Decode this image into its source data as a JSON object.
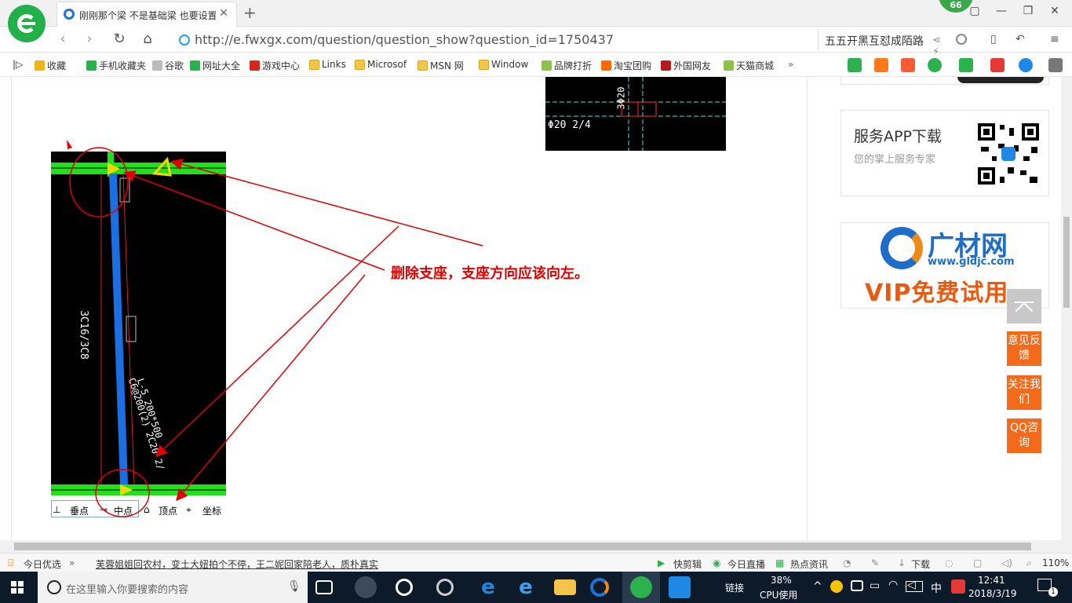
{
  "browser": {
    "tab_title": "刚刚那个梁 不是基础梁 也要设置",
    "tab_close": "✕",
    "new_tab": "+",
    "badge": "66",
    "url": "http://e.fwxgx.com/question/question_show?question_id=1750437",
    "search_text": "五五开黑互怼成陌路"
  },
  "bookmarks": [
    {
      "label": "收藏",
      "color": "#f3b21a"
    },
    {
      "label": "手机收藏夹",
      "color": "#2bb24c"
    },
    {
      "label": "谷歌",
      "color": "#bbbbbb"
    },
    {
      "label": "网址大全",
      "color": "#2bb24c"
    },
    {
      "label": "游戏中心",
      "color": "#d9261c"
    },
    {
      "label": "Links",
      "color": "folder"
    },
    {
      "label": "Microsof",
      "color": "folder"
    },
    {
      "label": "MSN 网",
      "color": "folder"
    },
    {
      "label": "Window",
      "color": "folder"
    },
    {
      "label": "品牌打折",
      "color": "#8bc34a"
    },
    {
      "label": "淘宝团购",
      "color": "#ff6a00"
    },
    {
      "label": "外国网友",
      "color": "#b71c1c"
    },
    {
      "label": "天猫商城",
      "color": "#8bc34a"
    }
  ],
  "bookmarks_more": "»",
  "cad_top": {
    "label": "Φ20 2/4",
    "vertical_label": "3Φ20"
  },
  "cad_main": {
    "beam_label": "3C16/3C8",
    "section_label_1": "L-5 200*500",
    "section_label_2": "C6@200(2) 2C20 2/"
  },
  "cad_tools": {
    "perpendicular": "垂点",
    "midpoint": "中点",
    "vertex": "顶点",
    "coordinate": "坐标"
  },
  "annotation": "删除支座，支座方向应该向左。",
  "sidebar": {
    "app_title": "服务APP下载",
    "app_sub": "您的掌上服务专家",
    "gc_name": "广材网",
    "gc_url": "www.gldjc.com",
    "gc_vip": "VIP免费试用"
  },
  "float_buttons": {
    "feedback": "意见反馈",
    "follow": "关注我们",
    "qq": "QQ咨询"
  },
  "statusbar": {
    "today_pick": "今日优选",
    "news": "芙蓉姐姐回农村，变土大妞拍个不停，王二妮回家陪老人，质朴真实",
    "quick_edit": "快剪辑",
    "today_live": "今日直播",
    "hot_news": "热点资讯",
    "download": "下载",
    "zoom": "110%"
  },
  "taskbar": {
    "search_placeholder": "在这里输入你要搜索的内容",
    "link": "链接",
    "cpu_percent": "38%",
    "cpu_label": "CPU使用",
    "ime": "中",
    "time": "12:41",
    "date": "2018/3/19",
    "notification_count": "1"
  },
  "colors": {
    "annotation_red": "#e00000",
    "float_orange": "#f36b1a",
    "cad_green": "#22e11a",
    "cad_blue": "#1b6fe0",
    "cad_yellow": "#f5d800"
  }
}
